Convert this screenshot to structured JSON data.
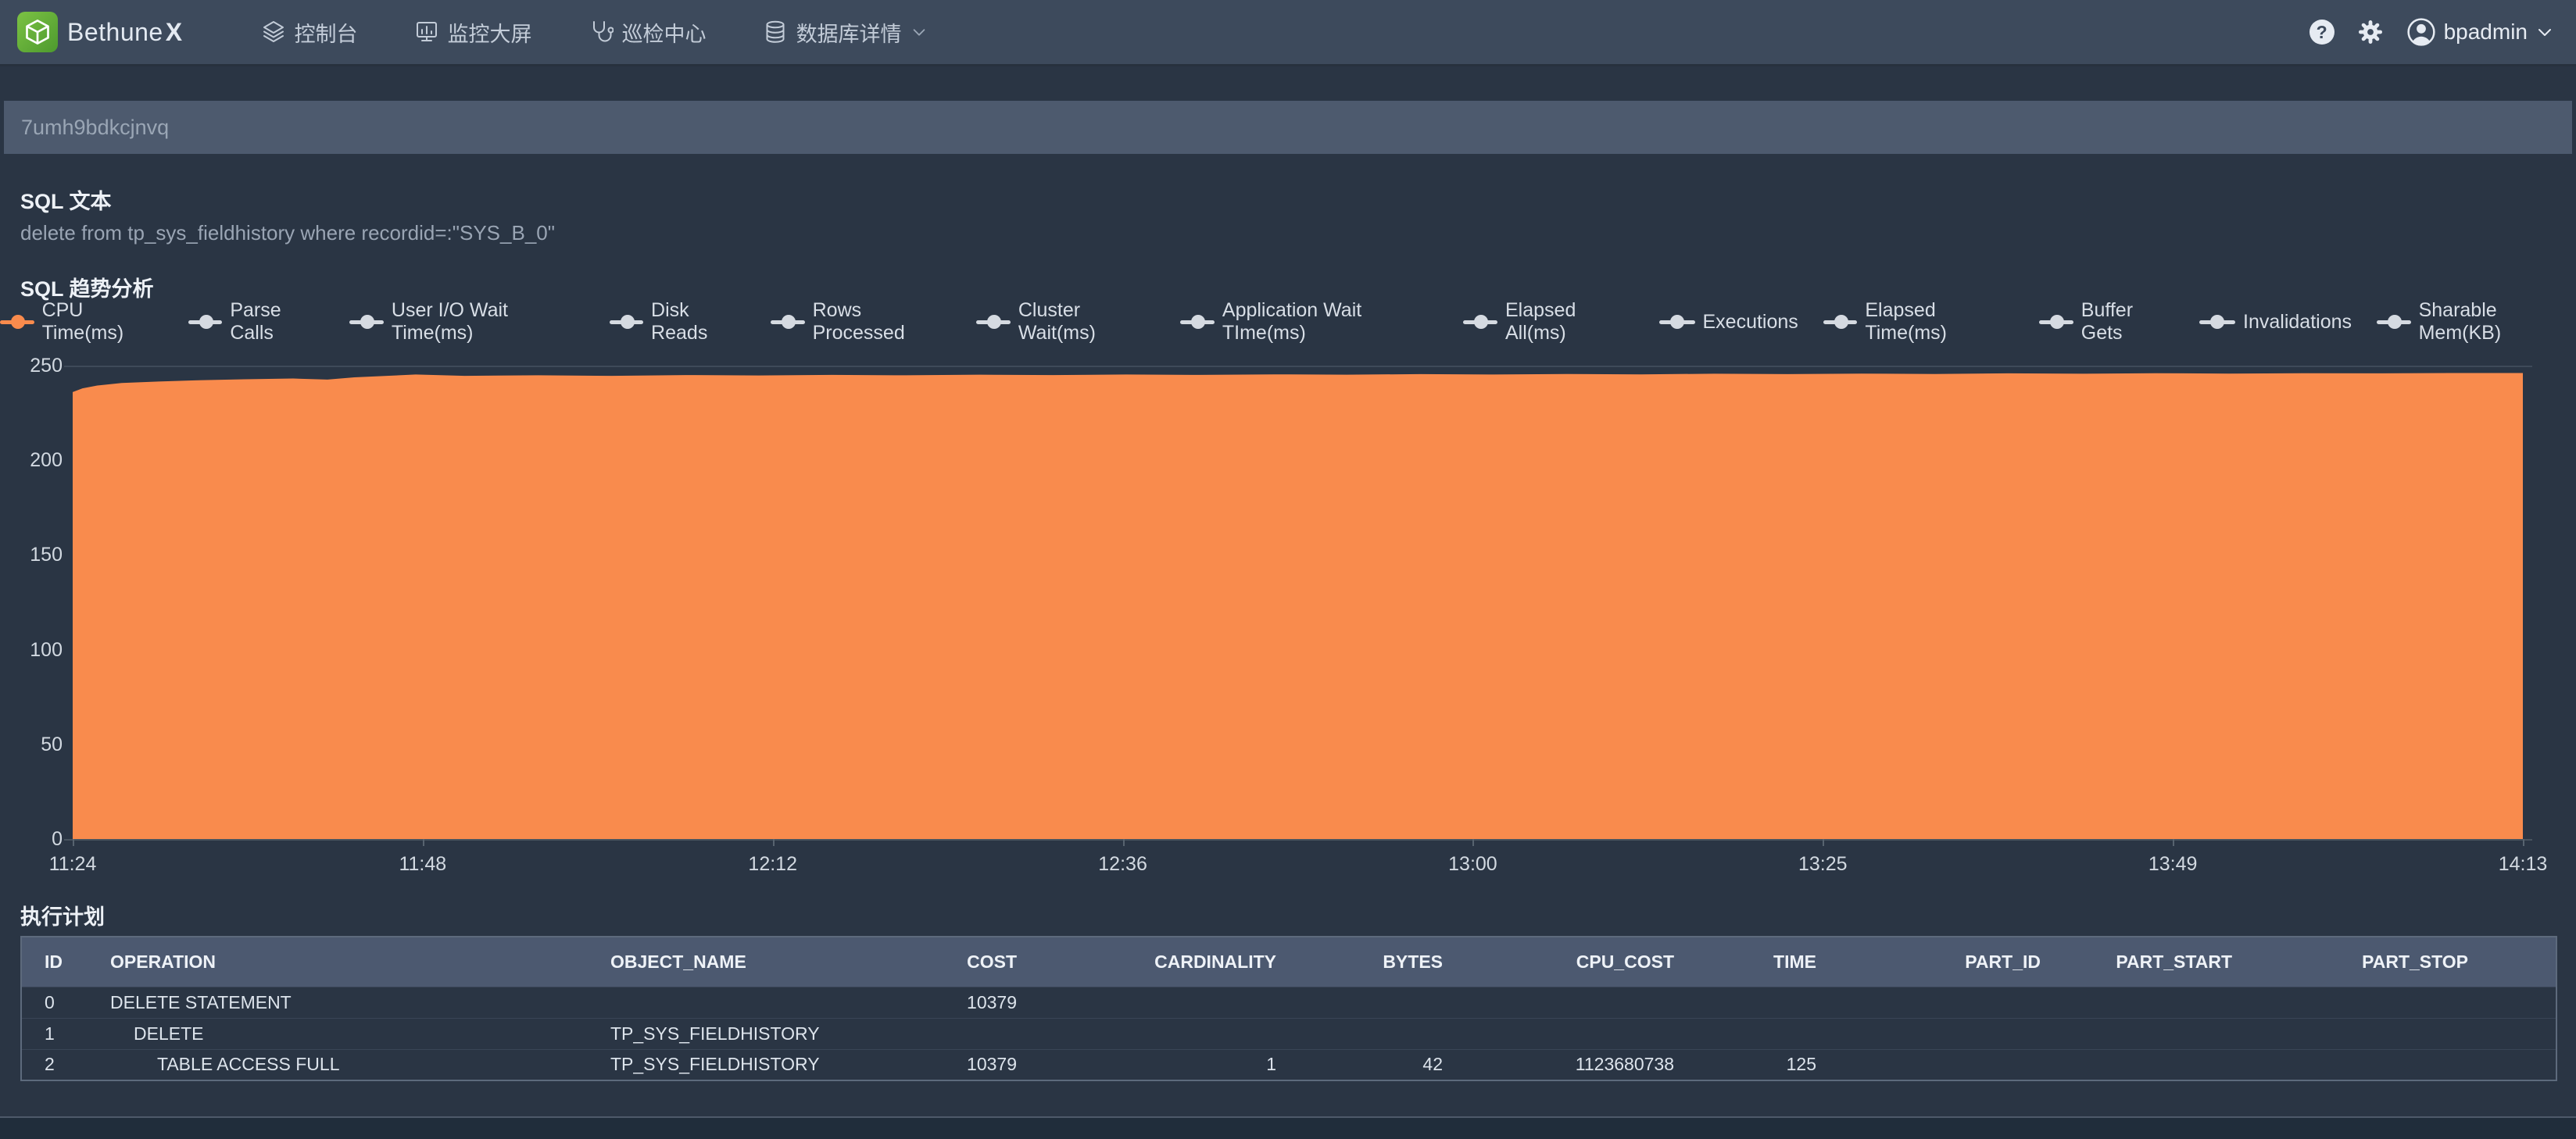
{
  "navbar": {
    "brand": "Bethune",
    "brand_suffix": "X",
    "items": [
      {
        "label": "控制台"
      },
      {
        "label": "监控大屏"
      },
      {
        "label": "巡检中心"
      },
      {
        "label": "数据库详情"
      }
    ],
    "help_glyph": "?",
    "username": "bpadmin"
  },
  "sql_id": "7umh9bdkcjnvq",
  "sql_text_section": {
    "title": "SQL 文本",
    "text": "delete from tp_sys_fieldhistory where recordid=:\"SYS_B_0\""
  },
  "trend_section": {
    "title": "SQL 趋势分析"
  },
  "chart_data": {
    "type": "area",
    "title": "SQL 趋势分析",
    "series_name": "CPU Time(ms)",
    "color": "#f98b4d",
    "inactive_color": "#d5dae1",
    "legend": [
      {
        "label": "CPU Time(ms)",
        "active": true
      },
      {
        "label": "Parse Calls",
        "active": false
      },
      {
        "label": "User I/O Wait Time(ms)",
        "active": false
      },
      {
        "label": "Disk Reads",
        "active": false
      },
      {
        "label": "Rows Processed",
        "active": false
      },
      {
        "label": "Cluster Wait(ms)",
        "active": false
      },
      {
        "label": "Application Wait TIme(ms)",
        "active": false
      },
      {
        "label": "Elapsed All(ms)",
        "active": false
      },
      {
        "label": "Executions",
        "active": false
      },
      {
        "label": "Elapsed Time(ms)",
        "active": false
      },
      {
        "label": "Buffer Gets",
        "active": false
      },
      {
        "label": "Invalidations",
        "active": false
      },
      {
        "label": "Sharable Mem(KB)",
        "active": false
      }
    ],
    "x_ticks": [
      "11:24",
      "11:48",
      "12:12",
      "12:36",
      "13:00",
      "13:25",
      "13:49",
      "14:13"
    ],
    "y_ticks": [
      250,
      200,
      150,
      100,
      50,
      0
    ],
    "ylim": [
      0,
      250
    ],
    "grid": "top-line-only",
    "legend_position": "top-center",
    "points": [
      [
        0,
        236
      ],
      [
        0.004,
        238
      ],
      [
        0.01,
        239.5
      ],
      [
        0.02,
        240.8
      ],
      [
        0.035,
        241.6
      ],
      [
        0.05,
        242.2
      ],
      [
        0.07,
        242.8
      ],
      [
        0.09,
        243.2
      ],
      [
        0.104,
        242.6
      ],
      [
        0.115,
        243.8
      ],
      [
        0.14,
        245.3
      ],
      [
        0.16,
        244.6
      ],
      [
        0.19,
        244.9
      ],
      [
        0.22,
        244.6
      ],
      [
        0.25,
        245.0
      ],
      [
        0.28,
        244.8
      ],
      [
        0.31,
        245.1
      ],
      [
        0.34,
        244.9
      ],
      [
        0.37,
        245.2
      ],
      [
        0.4,
        245.0
      ],
      [
        0.43,
        245.3
      ],
      [
        0.46,
        245.1
      ],
      [
        0.49,
        245.4
      ],
      [
        0.52,
        245.2
      ],
      [
        0.55,
        245.5
      ],
      [
        0.58,
        245.3
      ],
      [
        0.61,
        245.6
      ],
      [
        0.64,
        245.4
      ],
      [
        0.67,
        245.7
      ],
      [
        0.7,
        245.5
      ],
      [
        0.73,
        245.8
      ],
      [
        0.76,
        245.6
      ],
      [
        0.79,
        245.9
      ],
      [
        0.82,
        245.7
      ],
      [
        0.85,
        246.0
      ],
      [
        0.88,
        245.8
      ],
      [
        0.91,
        246.0
      ],
      [
        0.94,
        245.9
      ],
      [
        0.97,
        246.1
      ],
      [
        1,
        246.1
      ]
    ]
  },
  "plan": {
    "title": "执行计划",
    "columns": [
      "ID",
      "OPERATION",
      "OBJECT_NAME",
      "COST",
      "CARDINALITY",
      "BYTES",
      "CPU_COST",
      "TIME",
      "PART_ID",
      "PART_START",
      "PART_STOP"
    ],
    "rows": [
      {
        "indent": 0,
        "cells": [
          "0",
          "DELETE STATEMENT",
          "",
          "10379",
          "",
          "",
          "",
          "",
          "",
          "",
          ""
        ]
      },
      {
        "indent": 1,
        "cells": [
          "1",
          "DELETE",
          "TP_SYS_FIELDHISTORY",
          "",
          "",
          "",
          "",
          "",
          "",
          "",
          ""
        ]
      },
      {
        "indent": 2,
        "cells": [
          "2",
          "TABLE ACCESS FULL",
          "TP_SYS_FIELDHISTORY",
          "10379",
          "1",
          "42",
          "1123680738",
          "125",
          "",
          "",
          ""
        ]
      }
    ]
  }
}
